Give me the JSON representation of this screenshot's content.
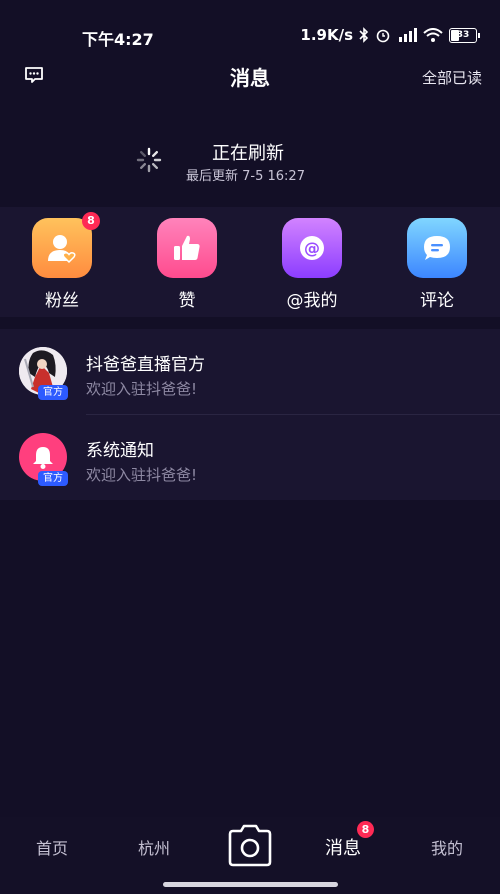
{
  "status_bar": {
    "time": "下午4:27",
    "network_speed": "1.9K/s",
    "battery": "33"
  },
  "header": {
    "title": "消息",
    "mark_all_read": "全部已读",
    "left_icon": "chat-bubble-icon"
  },
  "refresh": {
    "status": "正在刷新",
    "last_update": "最后更新 7-5 16:27"
  },
  "categories": [
    {
      "label": "粉丝",
      "icon": "fans-icon",
      "badge": "8",
      "color_from": "#ffb35a",
      "color_to": "#ff8a3d"
    },
    {
      "label": "赞",
      "icon": "thumbs-up-icon",
      "badge": "",
      "color_from": "#ff7ab0",
      "color_to": "#ff4d8d"
    },
    {
      "label": "@我的",
      "icon": "at-icon",
      "badge": "",
      "color_from": "#c77dff",
      "color_to": "#8a3dff"
    },
    {
      "label": "评论",
      "icon": "comment-icon",
      "badge": "",
      "color_from": "#7ad0ff",
      "color_to": "#3d8aff"
    }
  ],
  "messages": [
    {
      "title": "抖爸爸直播官方",
      "subtitle": "欢迎入驻抖爸爸!",
      "tag": "官方",
      "avatar": "anime-avatar"
    },
    {
      "title": "系统通知",
      "subtitle": "欢迎入驻抖爸爸!",
      "tag": "官方",
      "avatar": "bell-icon"
    }
  ],
  "tabbar": {
    "home": "首页",
    "city": "杭州",
    "messages": "消息",
    "messages_badge": "8",
    "me": "我的",
    "camera_icon": "camera-icon"
  }
}
